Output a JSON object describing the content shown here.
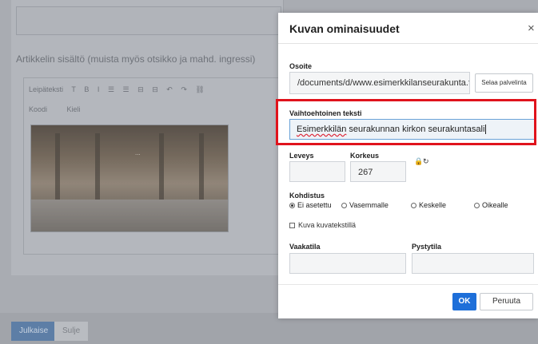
{
  "background": {
    "content_label": "Artikkelin sisältö (muista myös otsikko ja mahd. ingressi)",
    "toolbar": [
      "Leipäteksti",
      "T",
      "B",
      "I",
      "☰",
      "☰",
      "⊟",
      "⊟",
      "↶",
      "↷",
      "⛓"
    ],
    "toolbar2": [
      "Koodi",
      "Kieli"
    ],
    "image_caption": "...",
    "publish_label": "Julkaise",
    "close_label": "Sulje"
  },
  "dialog": {
    "title": "Kuvan ominaisuudet",
    "close_icon": "×",
    "address_label": "Osoite",
    "address_value": "/documents/d/www.esimerkkilanseurakunta.fi/sı",
    "browse_label": "Selaa palvelinta",
    "alt_label": "Vaihtoehtoinen teksti",
    "alt_value_misspelled": "Esimerkkilän",
    "alt_value_rest": " seurakunnan kirkon seurakuntasali",
    "width_label": "Leveys",
    "width_value": "",
    "height_label": "Korkeus",
    "height_value": "267",
    "lock_icon": "🔒",
    "reset_icon": "↻",
    "align_label": "Kohdistus",
    "align_options": [
      "Ei asetettu",
      "Vasemmalle",
      "Keskelle",
      "Oikealle"
    ],
    "align_selected": 0,
    "caption_checkbox": "Kuva kuvatekstillä",
    "hspace_label": "Vaakatila",
    "hspace_value": "",
    "vspace_label": "Pystytila",
    "vspace_value": "",
    "ok_label": "OK",
    "cancel_label": "Peruuta"
  },
  "colors": {
    "highlight": "#e0131c",
    "ok_button": "#1e6fd9"
  }
}
